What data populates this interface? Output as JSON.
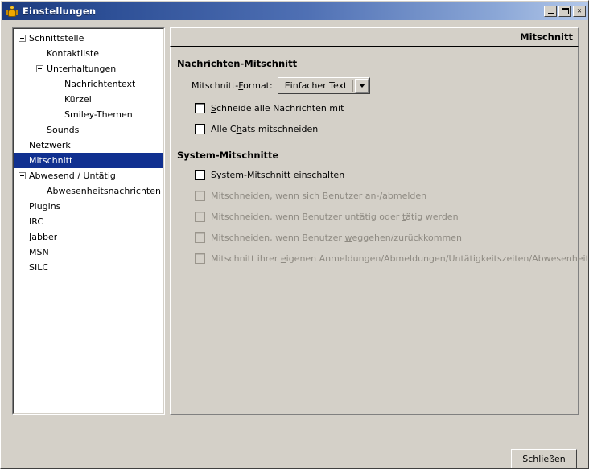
{
  "window": {
    "title": "Einstellungen",
    "icon": "buddy-person-icon",
    "controls": {
      "minimize": "_",
      "maximize": "□",
      "close": "✕"
    }
  },
  "sidebar": {
    "items": [
      {
        "label": "Schnittstelle",
        "indent": 0,
        "expander": "minus",
        "selected": false
      },
      {
        "label": "Kontaktliste",
        "indent": 1,
        "expander": "none",
        "selected": false
      },
      {
        "label": "Unterhaltungen",
        "indent": 1,
        "expander": "minus",
        "selected": false
      },
      {
        "label": "Nachrichtentext",
        "indent": 2,
        "expander": "none",
        "selected": false
      },
      {
        "label": "Kürzel",
        "indent": 2,
        "expander": "none",
        "selected": false
      },
      {
        "label": "Smiley-Themen",
        "indent": 2,
        "expander": "none",
        "selected": false
      },
      {
        "label": "Sounds",
        "indent": 1,
        "expander": "none",
        "selected": false
      },
      {
        "label": "Netzwerk",
        "indent": 0,
        "expander": "none",
        "selected": false
      },
      {
        "label": "Mitschnitt",
        "indent": 0,
        "expander": "none",
        "selected": true
      },
      {
        "label": "Abwesend / Untätig",
        "indent": 0,
        "expander": "minus",
        "selected": false
      },
      {
        "label": "Abwesenheitsnachrichten",
        "indent": 1,
        "expander": "none",
        "selected": false
      },
      {
        "label": "Plugins",
        "indent": 0,
        "expander": "none",
        "selected": false
      },
      {
        "label": "IRC",
        "indent": 0,
        "expander": "none",
        "selected": false
      },
      {
        "label": "Jabber",
        "indent": 0,
        "expander": "none",
        "selected": false
      },
      {
        "label": "MSN",
        "indent": 0,
        "expander": "none",
        "selected": false
      },
      {
        "label": "SILC",
        "indent": 0,
        "expander": "none",
        "selected": false
      }
    ]
  },
  "page": {
    "header_title": "Mitschnitt",
    "sections": [
      {
        "title": "Nachrichten-Mitschnitt",
        "format_label_pre": "Mitschnitt-",
        "format_label_mn": "F",
        "format_label_post": "ormat:",
        "format_value": "Einfacher Text",
        "checkboxes": [
          {
            "pre": "",
            "mn": "S",
            "post": "chneide alle Nachrichten mit",
            "checked": false,
            "disabled": false
          },
          {
            "pre": "Alle C",
            "mn": "h",
            "post": "ats mitschneiden",
            "checked": false,
            "disabled": false
          }
        ]
      },
      {
        "title": "System-Mitschnitte",
        "checkboxes": [
          {
            "pre": "System-",
            "mn": "M",
            "post": "itschnitt einschalten",
            "checked": false,
            "disabled": false
          },
          {
            "pre": "Mitschneiden, wenn sich ",
            "mn": "B",
            "post": "enutzer an-/abmelden",
            "checked": false,
            "disabled": true
          },
          {
            "pre": "Mitschneiden, wenn Benutzer untätig oder ",
            "mn": "t",
            "post": "ätig werden",
            "checked": false,
            "disabled": true
          },
          {
            "pre": "Mitschneiden, wenn Benutzer ",
            "mn": "w",
            "post": "eggehen/zurückkommen",
            "checked": false,
            "disabled": true
          },
          {
            "pre": "Mitschnitt ihrer ",
            "mn": "e",
            "post": "igenen Anmeldungen/Abmeldungen/Untätigkeitszeiten/Abwesenheitszeiten",
            "checked": false,
            "disabled": true
          }
        ]
      }
    ]
  },
  "footer": {
    "close_pre": "S",
    "close_mn": "c",
    "close_post": "hließen"
  },
  "colors": {
    "face": "#d4d0c8",
    "selection": "#103090",
    "title_start": "#1b3a7d",
    "title_end": "#b3c8ea",
    "disabled_text": "#8e8a82"
  }
}
